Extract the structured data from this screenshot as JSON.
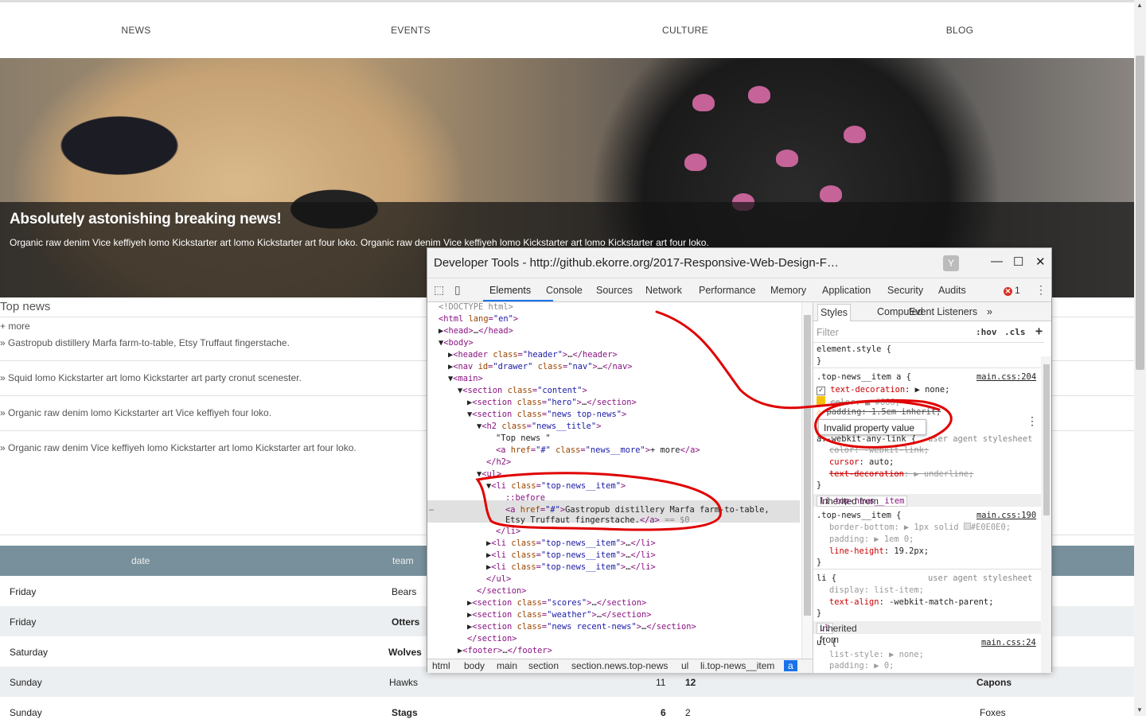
{
  "nav": {
    "items": [
      "NEWS",
      "EVENTS",
      "CULTURE",
      "BLOG"
    ]
  },
  "hero": {
    "title": "Absolutely astonishing breaking news!",
    "text": "Organic raw denim Vice keffiyeh lomo Kickstarter art lomo Kickstarter art four loko. Organic raw denim Vice keffiyeh lomo Kickstarter art lomo Kickstarter art four loko."
  },
  "top_news": {
    "title": "Top news",
    "more": "+ more",
    "items": [
      "» Gastropub distillery Marfa farm-to-table, Etsy Truffaut fingerstache.",
      "» Squid lomo Kickstarter art lomo Kickstarter art party cronut scenester.",
      "» Organic raw denim lomo Kickstarter art Vice keffiyeh four loko.",
      "» Organic raw denim Vice keffiyeh lomo Kickstarter art lomo Kickstarter art four loko."
    ]
  },
  "scores": {
    "headers": [
      "date",
      "team"
    ],
    "rows": [
      {
        "day": "Friday",
        "team": "Bears",
        "s1": "",
        "s2": "",
        "opp": ""
      },
      {
        "day": "Friday",
        "team": "Otters",
        "s1": "",
        "s2": "",
        "opp": ""
      },
      {
        "day": "Saturday",
        "team": "Wolves",
        "s1": "",
        "s2": "",
        "opp": ""
      },
      {
        "day": "Sunday",
        "team": "Hawks",
        "s1": "11",
        "s2": "12",
        "opp": "Capons"
      },
      {
        "day": "Sunday",
        "team": "Stags",
        "s1": "6",
        "s2": "2",
        "opp": "Foxes"
      }
    ]
  },
  "devtools": {
    "title": "Developer Tools - http://github.ekorre.org/2017-Responsive-Web-Design-F…",
    "tabs": [
      "Elements",
      "Console",
      "Sources",
      "Network",
      "Performance",
      "Memory",
      "Application",
      "Security",
      "Audits"
    ],
    "error_count": "1",
    "breadcrumbs": [
      "html",
      "body",
      "main",
      "section",
      "section.news.top-news",
      "ul",
      "li.top-news__item",
      "a"
    ],
    "styles_tabs": [
      "Styles",
      "Computed",
      "Event Listeners",
      "»"
    ],
    "filter_placeholder": "Filter",
    "filter_hov": ":hov",
    "filter_cls": ".cls",
    "tooltip": "Invalid property value",
    "inherited_1_label": "Inherited from",
    "inherited_1_sel": "li.top-news__item",
    "inherited_2_label": "Inherited from",
    "inherited_2_sel": "ul"
  },
  "colors": {
    "accent": "#1a73e8",
    "table_header": "#78909c",
    "annotation": "#e00000",
    "error": "#d93025"
  }
}
